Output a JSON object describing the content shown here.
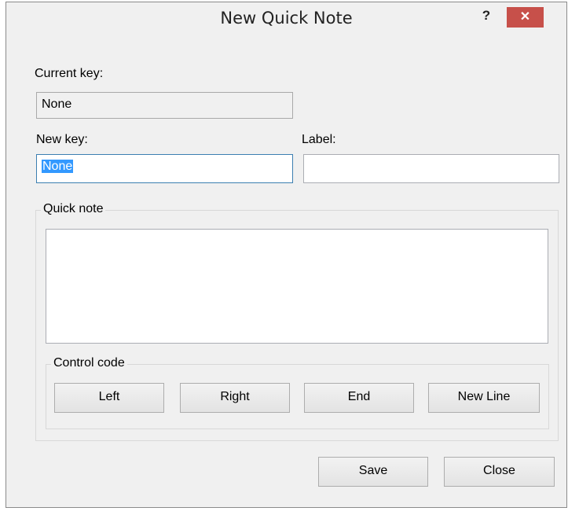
{
  "window": {
    "title": "New Quick Note",
    "help_label": "?",
    "close_label": "✕"
  },
  "current_key": {
    "label": "Current key:",
    "value": "None"
  },
  "new_key": {
    "label": "New key:",
    "value": "None"
  },
  "label_field": {
    "label": "Label:",
    "value": ""
  },
  "quick_note": {
    "group_label": "Quick note",
    "text": ""
  },
  "control_code": {
    "group_label": "Control code",
    "buttons": [
      "Left",
      "Right",
      "End",
      "New Line"
    ]
  },
  "footer": {
    "save_label": "Save",
    "close_label": "Close"
  },
  "colors": {
    "close_button": "#c7504a",
    "selection": "#3399ff",
    "focus_border": "#3c7fb1"
  }
}
